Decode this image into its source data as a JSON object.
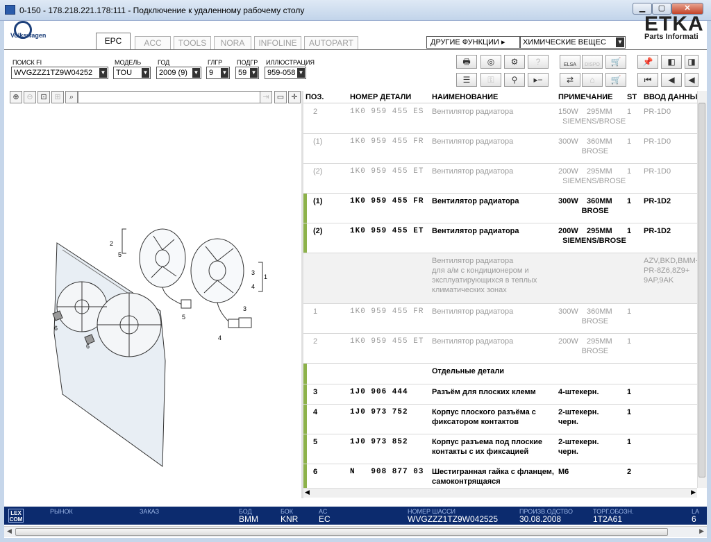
{
  "window": {
    "title": "0-150 - 178.218.221.178:111 - Подключение к удаленному рабочему столу"
  },
  "brand": {
    "vw": "Volkswagen",
    "etka": "ETKA",
    "etka_sub": "Parts Informati"
  },
  "tabs": [
    "EPC",
    "ACC",
    "TOOLS",
    "NORA",
    "INFOLINE",
    "AUTOPART"
  ],
  "other_functions": "ДРУГИЕ ФУНКЦИИ ▸",
  "chemicals": "ХИМИЧЕСКИЕ ВЕЩЕС",
  "filters": {
    "fi_label": "ПОИСК FI",
    "fi_value": "WVGZZZ1TZ9W04252",
    "model_label": "МОДЕЛЬ",
    "model_value": "TOU",
    "year_label": "ГОД",
    "year_value": "2009 (9)",
    "mg_label": "ГЛГР",
    "mg_value": "9",
    "sg_label": "ПОДГР",
    "sg_value": "59",
    "illus_label": "ИЛЛЮСТРАЦИЯ",
    "illus_value": "959-058"
  },
  "toolbar": {
    "elsa": "ELSA",
    "dispo": "DISPO"
  },
  "columns": {
    "pos": "ПОЗ.",
    "part": "НОМЕР ДЕТАЛИ",
    "name": "НАИМЕНОВАНИЕ",
    "note": "ПРИМЕЧАНИЕ",
    "st": "ST",
    "input": "ВВОД ДАННЫХ"
  },
  "rows": [
    {
      "pos": "2",
      "part": "1K0 959 455 ES",
      "name": "Вентилятор радиатора",
      "note": "150W    295MM\n  SIEMENS/BROSE",
      "st": "1",
      "input": "PR-1D0",
      "state": "dim"
    },
    {
      "pos": "(1)",
      "part": "1K0 959 455 FR",
      "name": "Вентилятор радиатора",
      "note": "300W    360MM\n           BROSE",
      "st": "1",
      "input": "PR-1D0",
      "state": "dim"
    },
    {
      "pos": "(2)",
      "part": "1K0 959 455 ET",
      "name": "Вентилятор радиатора",
      "note": "200W    295MM\n  SIEMENS/BROSE",
      "st": "1",
      "input": "PR-1D0",
      "state": "dim"
    },
    {
      "pos": "(1)",
      "part": "1K0 959 455 FR",
      "name": "Вентилятор радиатора",
      "note": "300W    360MM\n           BROSE",
      "st": "1",
      "input": "PR-1D2",
      "state": "active"
    },
    {
      "pos": "(2)",
      "part": "1K0 959 455 ET",
      "name": "Вентилятор радиатора",
      "note": "200W    295MM\n  SIEMENS/BROSE",
      "st": "1",
      "input": "PR-1D2",
      "state": "active"
    },
    {
      "pos": "",
      "part": "",
      "name": "Вентилятор радиатора\nдля а/м с кондиционером и\nэксплуатирующихся в теплых\nклиматических зонах",
      "note": "",
      "st": "",
      "input": "AZV,BKD,BMM+\nPR-8Z6,8Z9+\n9AP,9AK",
      "state": "dimgrey"
    },
    {
      "pos": "1",
      "part": "1K0 959 455 FR",
      "name": "Вентилятор радиатора",
      "note": "300W    360MM\n           BROSE",
      "st": "1",
      "input": "",
      "state": "dim"
    },
    {
      "pos": "2",
      "part": "1K0 959 455 ET",
      "name": "Вентилятор радиатора",
      "note": "200W    295MM\n           BROSE",
      "st": "1",
      "input": "",
      "state": "dim"
    },
    {
      "pos": "",
      "part": "",
      "name": "Отдельные детали",
      "note": "",
      "st": "",
      "input": "",
      "state": "active"
    },
    {
      "pos": "3",
      "part": "1J0 906 444",
      "name": "Разъём для плоских клемм",
      "note": "4-штекерн.",
      "st": "1",
      "input": "",
      "state": "active"
    },
    {
      "pos": "4",
      "part": "1J0 973 752",
      "name": "Корпус плоского разъёма с\nфиксатором контактов",
      "note": "2-штекерн.\nчерн.",
      "st": "1",
      "input": "",
      "state": "active"
    },
    {
      "pos": "5",
      "part": "1J0 973 852",
      "name": "Корпус разъема под плоские\nконтакты с их фиксацией",
      "note": "2-штекерн.\nчерн.",
      "st": "1",
      "input": "",
      "state": "active"
    },
    {
      "pos": "6",
      "part": "N   908 877 03",
      "name": "Шестигранная гайка с фланцем,\nсамоконтрящаяся",
      "note": "M6",
      "st": "2",
      "input": "",
      "state": "active"
    }
  ],
  "illustration": {
    "callouts": [
      "2",
      "5",
      "3",
      "1",
      "4",
      "5",
      "3",
      "4",
      "6",
      "6"
    ]
  },
  "status": {
    "market_label": "РЫНОК",
    "order_label": "ЗАКАЗ",
    "body_label": "БОД",
    "body_value": "BMM",
    "gearbox_label": "БОК",
    "gearbox_value": "KNR",
    "ac_label": "АС",
    "ac_value": "EC",
    "chassis_label": "НОМЕР ШАССИ",
    "chassis_value": "WVGZZZ1TZ9W042525",
    "prod_label": "ПРОИЗВ.ОДСТВО",
    "prod_value": "30.08.2008",
    "trade_label": "ТОРГ.ОБОЗН.",
    "trade_value": "1T2A61",
    "lang_label": "LA",
    "lang_value": "6",
    "lexcom": "LEX\nCOM"
  }
}
